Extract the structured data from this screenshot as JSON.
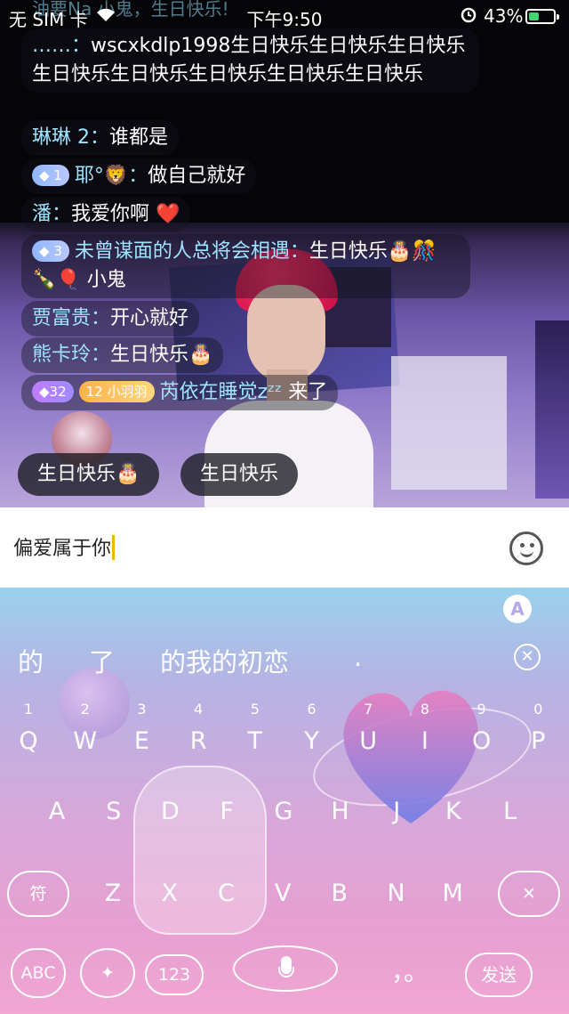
{
  "status_bar": {
    "carrier": "无 SIM 卡",
    "wifi_icon": "wifi-icon",
    "time": "下午9:50",
    "alarm_icon": "alarm-icon",
    "battery_percent": "43%",
    "battery_level": 0.43,
    "charging_icon": "bolt-icon"
  },
  "chat": {
    "partial_top": "油要Na   小鬼，生日快乐!",
    "messages": [
      {
        "name": "……：",
        "text": "wscxkdlp1998生日快乐生日快乐生日快乐生日快乐生日快乐生日快乐生日快乐生日快乐"
      },
      {
        "name": "琳琳 2：",
        "text": "谁都是"
      },
      {
        "badge": "1",
        "name": "耶°🦁：",
        "text": "做自己就好"
      },
      {
        "name": "潘：",
        "text": "我爱你啊 ❤️"
      },
      {
        "badge": "3",
        "name": "未曾谋面的人总将会相遇：",
        "text": "生日快乐🎂🎊🍾🎈 小鬼"
      },
      {
        "name": "贾富贵：",
        "text": "开心就好"
      },
      {
        "name": "熊卡玲：",
        "text": "生日快乐🎂"
      },
      {
        "badge": "32",
        "badge2": "12 小羽羽",
        "name": "芮依在睡觉",
        "zzz": "zᶻᶻ",
        "text": "来了"
      }
    ],
    "quick_replies": [
      "生日快乐🎂",
      "生日快乐"
    ]
  },
  "input": {
    "value": "偏爱属于你",
    "emoji_icon": "smiley-icon"
  },
  "keyboard": {
    "candidates": [
      "的",
      "了",
      "的我的初恋",
      "."
    ],
    "row1": [
      "Q",
      "W",
      "E",
      "R",
      "T",
      "Y",
      "U",
      "I",
      "O",
      "P"
    ],
    "row1_numbers": [
      "1",
      "2",
      "3",
      "4",
      "5",
      "6",
      "7",
      "8",
      "9",
      "0"
    ],
    "row2": [
      "A",
      "S",
      "D",
      "F",
      "G",
      "H",
      "J",
      "K",
      "L"
    ],
    "row3": [
      "Z",
      "X",
      "C",
      "V",
      "B",
      "N",
      "M"
    ],
    "symbol_key": "符",
    "abc_key": "ABC",
    "num_key": "123",
    "punctuation": "，。",
    "send_key": "发送",
    "logo": "A",
    "colors": {
      "gradient_top": "#9ad1ec",
      "gradient_bottom": "#f0a7d4",
      "caret": "#f1b40a",
      "chat_name": "#9fe4ff"
    }
  }
}
